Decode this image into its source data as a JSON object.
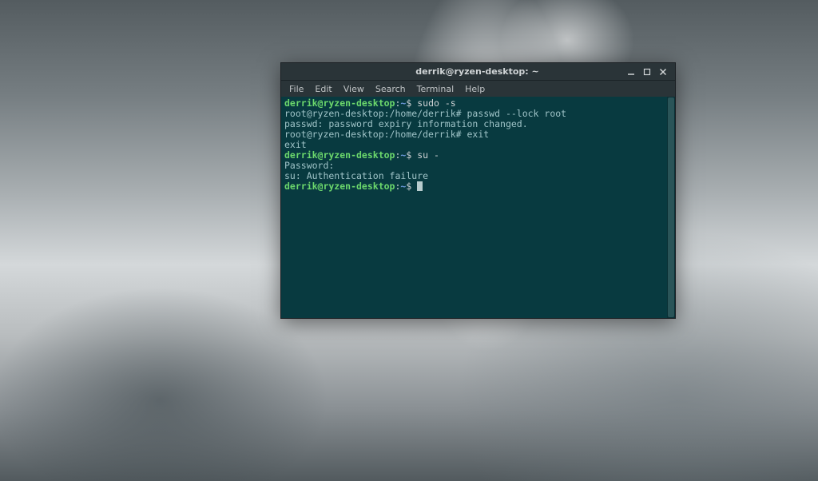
{
  "window": {
    "title": "derrik@ryzen-desktop: ~"
  },
  "menubar": {
    "file": "File",
    "edit": "Edit",
    "view": "View",
    "search": "Search",
    "terminal": "Terminal",
    "help": "Help"
  },
  "terminal": {
    "lines": [
      {
        "type": "prompt_cmd",
        "user": "derrik@ryzen-desktop",
        "sep": ":",
        "path": "~",
        "sym": "$ ",
        "cmd": "sudo -s"
      },
      {
        "type": "root_cmd",
        "text": "root@ryzen-desktop:/home/derrik# passwd --lock root"
      },
      {
        "type": "output",
        "text": "passwd: password expiry information changed."
      },
      {
        "type": "root_cmd",
        "text": "root@ryzen-desktop:/home/derrik# exit"
      },
      {
        "type": "output",
        "text": "exit"
      },
      {
        "type": "prompt_cmd",
        "user": "derrik@ryzen-desktop",
        "sep": ":",
        "path": "~",
        "sym": "$ ",
        "cmd": "su -"
      },
      {
        "type": "output",
        "text": "Password:"
      },
      {
        "type": "output",
        "text": "su: Authentication failure"
      },
      {
        "type": "prompt_cursor",
        "user": "derrik@ryzen-desktop",
        "sep": ":",
        "path": "~",
        "sym": "$ "
      }
    ]
  }
}
